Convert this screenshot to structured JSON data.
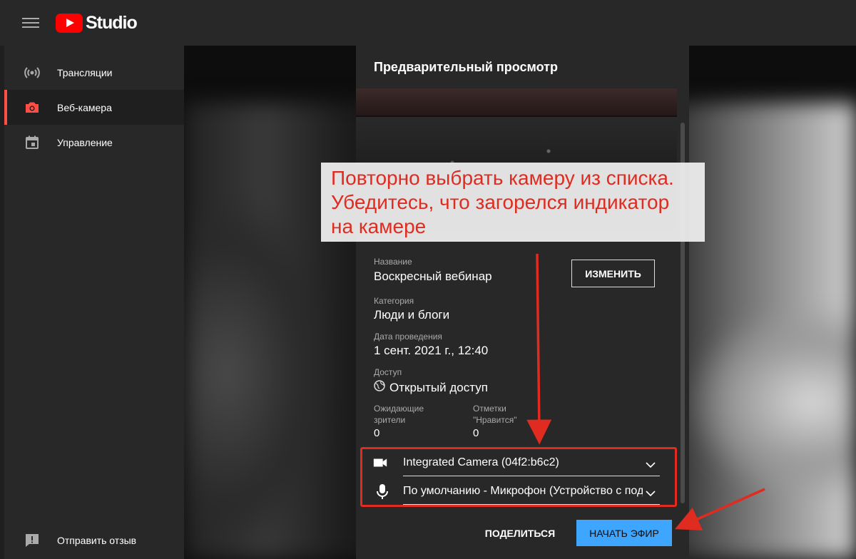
{
  "app": {
    "logo_text": "Studio",
    "brand_color": "#ff0000",
    "accent_color": "#3ea6ff",
    "annotation_color": "#e02b20"
  },
  "sidebar": {
    "items": [
      {
        "label": "Трансляции",
        "icon": "broadcast-icon"
      },
      {
        "label": "Веб-камера",
        "icon": "camera-icon",
        "active": true
      },
      {
        "label": "Управление",
        "icon": "calendar-icon"
      }
    ],
    "feedback": {
      "label": "Отправить отзыв",
      "icon": "feedback-icon"
    }
  },
  "dialog": {
    "title": "Предварительный просмотр",
    "fields": {
      "title_label": "Название",
      "title_value": "Воскресный вебинар",
      "category_label": "Категория",
      "category_value": "Люди и блоги",
      "date_label": "Дата проведения",
      "date_value": "1 сент. 2021 г., 12:40",
      "access_label": "Доступ",
      "access_value": "Открытый доступ",
      "waiting_label_1": "Ожидающие",
      "waiting_label_2": "зрители",
      "waiting_value": "0",
      "likes_label_1": "Отметки",
      "likes_label_2": "\"Нравится\"",
      "likes_value": "0"
    },
    "edit_button": "ИЗМЕНИТЬ",
    "camera": {
      "selected": "Integrated Camera (04f2:b6c2)"
    },
    "microphone": {
      "selected": "По умолчанию - Микрофон (Устройство с поддержкой High Definition Audio)"
    },
    "share_button": "ПОДЕЛИТЬСЯ",
    "go_live_button": "НАЧАТЬ ЭФИР"
  },
  "annotation": {
    "line1": "Повторно выбрать камеру из списка.",
    "line2": "Убедитесь, что загорелся индикатор",
    "line3": "на камере"
  }
}
